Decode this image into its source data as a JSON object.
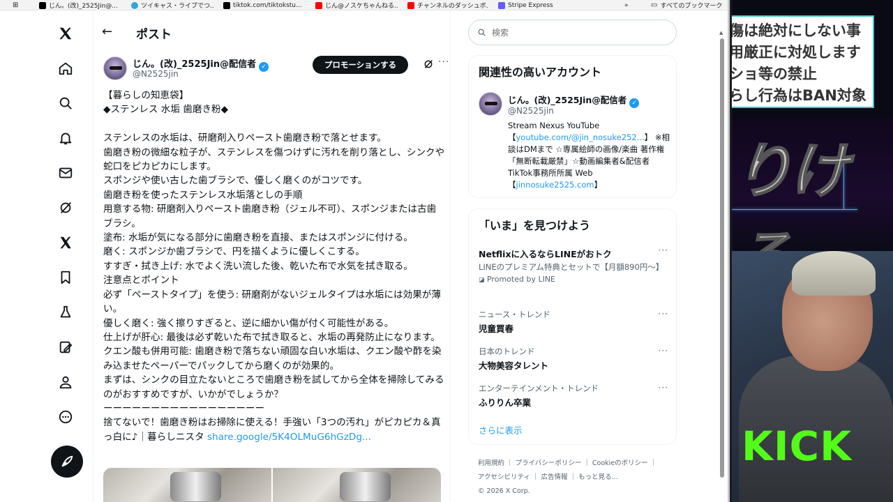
{
  "bookmarks": [
    {
      "label": "じん。(改)_2525Jin@...",
      "color": "#000000"
    },
    {
      "label": "ツイキャス・ライブでつ...",
      "color": "#2aa6e0"
    },
    {
      "label": "tiktok.com/tiktokstu...",
      "color": "#000000"
    },
    {
      "label": "じん@ノスケちゃんねる...",
      "color": "#ff0000"
    },
    {
      "label": "チャンネルのダッシュボ...",
      "color": "#ff0000"
    },
    {
      "label": "Stripe Express",
      "color": "#635bff"
    },
    {
      "label": "»",
      "color": ""
    },
    {
      "label": "すべてのブックマーク",
      "color": ""
    }
  ],
  "header": {
    "title": "ポスト"
  },
  "post": {
    "author_name": "じん。(改)_2525Jin@配信者",
    "author_handle": "@N2525jin",
    "promote_label": "プロモーションする",
    "body": "【暮らしの知恵袋】\n◆ステンレス 水垢 歯磨き粉◆\n\nステンレスの水垢は、研磨剤入りペースト歯磨き粉で落とせます。\n歯磨き粉の微細な粒子が、ステンレスを傷つけずに汚れを削り落とし、シンクや蛇口をピカピカにします。\nスポンジや使い古した歯ブラシで、優しく磨くのがコツです。\n歯磨き粉を使ったステンレス水垢落としの手順\n用意する物: 研磨剤入りペースト歯磨き粉（ジェル不可）、スポンジまたは古歯ブラシ。\n塗布: 水垢が気になる部分に歯磨き粉を直接、またはスポンジに付ける。\n磨く: スポンジか歯ブラシで、円を描くように優しくこする。\nすすぎ・拭き上げ: 水でよく洗い流した後、乾いた布で水気を拭き取る。\n注意点とポイント\n必ず「ペーストタイプ」を使う: 研磨剤がないジェルタイプは水垢には効果が薄い。\n優しく磨く: 強く擦りすぎると、逆に細かい傷が付く可能性がある。\n仕上げが肝心: 最後は必ず乾いた布で拭き取ると、水垢の再発防止になります。\nクエン酸も併用可能: 歯磨き粉で落ちない頑固な白い水垢は、クエン酸や酢を染み込ませたペーパーでパックしてから磨くのが効果的。\nまずは、シンクの目立たないところで歯磨き粉を試してから全体を掃除してみるのがおすすめですが、いかがでしょうか？\nーーーーーーーーーーーーーーーーー\n捨てないで！歯磨き粉はお掃除に使える！手強い「3つの汚れ」がピカピカ＆真っ白に♪｜暮らしニスタ ",
    "link_text": "share.google/5K4OLMuG6hGzDg..."
  },
  "search": {
    "placeholder": "検索"
  },
  "related": {
    "title": "関連性の高いアカウント",
    "name": "じん。(改)_2525Jin@配信者",
    "handle": "@N2525jin",
    "bio_prefix": "Stream Nexus YouTube 【",
    "bio_link1": "youtube.com/@jin_nosuke252...",
    "bio_middle": "】 ※相談はDMまで ☆専属絵師の画像/楽曲 著作権「無断転載厳禁」☆動画編集者&配信者 TikTok事務所所属 Web【",
    "bio_link2": "jinnosuke2525.com",
    "bio_suffix": "】"
  },
  "trends": {
    "title": "「いま」を見つけよう",
    "items": [
      {
        "category": "",
        "name": "Netflixに入るならLINEがおトク",
        "desc": "LINEのプレミアム特典とセットで【月額890円〜】",
        "promo": "Promoted by LINE"
      },
      {
        "category": "ニュース・トレンド",
        "name": "児童買春",
        "desc": "",
        "promo": ""
      },
      {
        "category": "日本のトレンド",
        "name": "大物美容タレント",
        "desc": "",
        "promo": ""
      },
      {
        "category": "エンターテインメント・トレンド",
        "name": "ふりりん卒業",
        "desc": "",
        "promo": ""
      }
    ],
    "show_more": "さらに表示"
  },
  "footer": {
    "links": [
      "利用規約",
      "プライバシーポリシー",
      "Cookieのポリシー",
      "アクセシビリティ",
      "広告情報",
      "もっと見る…"
    ],
    "copyright": "© 2026 X Corp."
  },
  "overlay": {
    "rules": [
      "傷は絶対にしない事",
      "用厳正に対処します",
      "ショ等の禁止",
      "らし行為はBAN対象"
    ],
    "kana": "りける",
    "kick": "KICK"
  },
  "colors": {
    "accent": "#1d9bf0",
    "kick": "#53fc18",
    "rules_border": "#43c7c1"
  }
}
